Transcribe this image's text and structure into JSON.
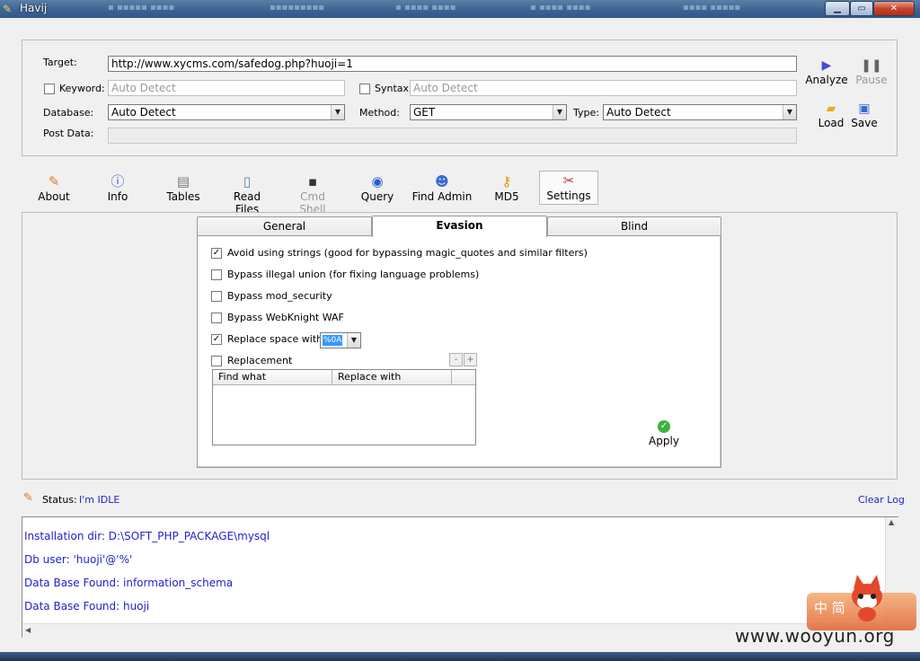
{
  "window": {
    "title": "Havij",
    "controls": [
      "minimize",
      "maximize",
      "close"
    ]
  },
  "target_panel": {
    "target": {
      "label": "Target:",
      "value": "http://www.xycms.com/safedog.php?huoji=1"
    },
    "keyword": {
      "label": "Keyword:",
      "checked": false,
      "placeholder": "Auto Detect"
    },
    "syntax": {
      "label": "Syntax:",
      "checked": false,
      "placeholder": "Auto Detect"
    },
    "database": {
      "label": "Database:",
      "value": "Auto Detect"
    },
    "method": {
      "label": "Method:",
      "value": "GET"
    },
    "type": {
      "label": "Type:",
      "value": "Auto Detect"
    },
    "post_data": {
      "label": "Post Data:",
      "value": ""
    },
    "buttons": {
      "analyze": "Analyze",
      "pause": "Pause",
      "load": "Load",
      "save": "Save"
    }
  },
  "toolbar": [
    {
      "label": "About",
      "icon": "pen-icon"
    },
    {
      "label": "Info",
      "icon": "info-icon"
    },
    {
      "label": "Tables",
      "icon": "table-icon"
    },
    {
      "label": "Read Files",
      "icon": "file-icon"
    },
    {
      "label": "Cmd Shell",
      "icon": "terminal-icon",
      "disabled": true
    },
    {
      "label": "Query",
      "icon": "query-icon"
    },
    {
      "label": "Find Admin",
      "icon": "users-icon"
    },
    {
      "label": "MD5",
      "icon": "key-icon"
    },
    {
      "label": "Settings",
      "icon": "tools-icon",
      "active": true
    }
  ],
  "settings": {
    "tabs": [
      "General",
      "Evasion",
      "Blind"
    ],
    "active_tab": "Evasion",
    "options": [
      {
        "label": "Avoid using strings (good for bypassing magic_quotes and similar filters)",
        "checked": true
      },
      {
        "label": "Bypass illegal union (for fixing language problems)",
        "checked": false
      },
      {
        "label": "Bypass mod_security",
        "checked": false
      },
      {
        "label": "Bypass WebKnight WAF",
        "checked": false
      },
      {
        "label": "Replace space with:",
        "checked": true
      },
      {
        "label": "Replacement",
        "checked": false
      }
    ],
    "replace_space_value": "%0A",
    "replacement_table": {
      "columns": [
        "Find what",
        "Replace with"
      ],
      "rows": []
    },
    "minus_label": "-",
    "plus_label": "+",
    "apply_label": "Apply"
  },
  "status": {
    "label": "Status:",
    "value": "I'm IDLE",
    "clear_log": "Clear Log"
  },
  "log": [
    "Installation dir: D:\\SOFT_PHP_PACKAGE\\mysql",
    "Db user: 'huoji'@'%'",
    "Data Base Found: information_schema",
    "Data Base Found: huoji"
  ],
  "watermark": {
    "text": "www.wooyun.org",
    "badge": "中 简"
  },
  "colors": {
    "log_text": "#2222cc",
    "status_value": "#2222cc",
    "titlebar": "#3d6493"
  }
}
